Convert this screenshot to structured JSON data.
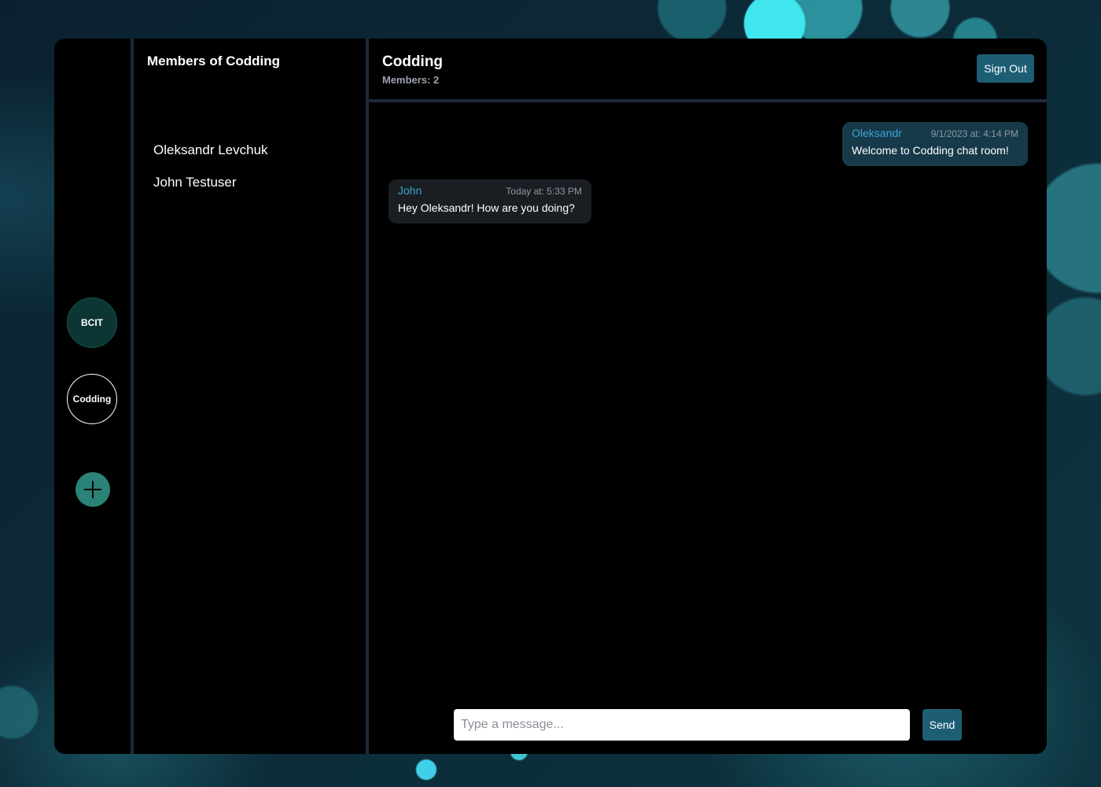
{
  "colors": {
    "panel": "#000000",
    "divider": "#1f2a38",
    "accent_button": "#1e5e75",
    "author_name": "#37a6d4",
    "own_bubble": "#173a4b",
    "other_bubble": "#1a1e23",
    "add_button": "#2b8277",
    "bcit_server": "#0c3633"
  },
  "servers": [
    {
      "label": "BCIT",
      "active": false
    },
    {
      "label": "Codding",
      "active": true
    }
  ],
  "add_server_icon": "plus-icon",
  "members_panel": {
    "title": "Members of Codding",
    "members": [
      "Oleksandr Levchuk",
      "John Testuser"
    ]
  },
  "chat": {
    "title": "Codding",
    "member_count": "Members: 2",
    "sign_out_label": "Sign Out",
    "messages": [
      {
        "author": "Oleksandr",
        "time": "9/1/2023 at: 4:14 PM",
        "text": "Welcome to Codding chat room!",
        "own": true
      },
      {
        "author": "John",
        "time": "Today at: 5:33 PM",
        "text": "Hey Oleksandr! How are you doing?",
        "own": false
      }
    ],
    "composer": {
      "placeholder": "Type a message...",
      "value": "",
      "send_label": "Send"
    }
  }
}
